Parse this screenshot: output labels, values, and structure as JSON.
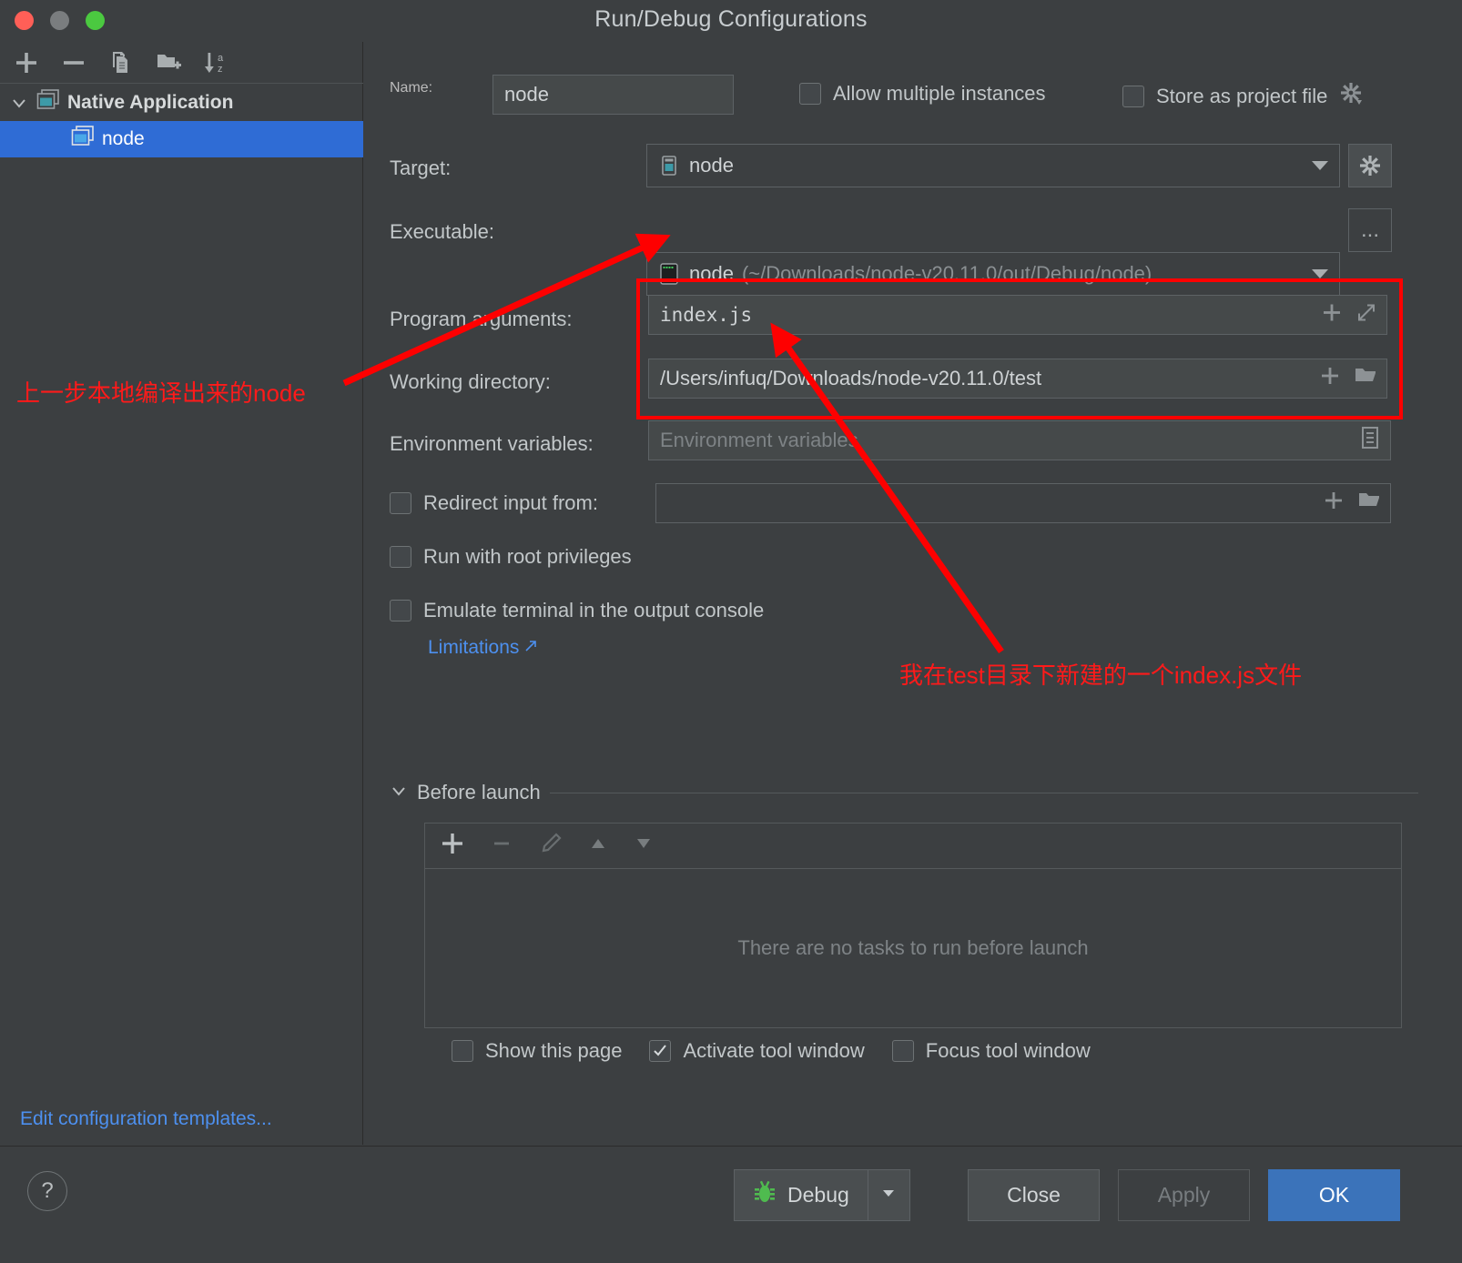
{
  "window": {
    "title": "Run/Debug Configurations",
    "traffic_lights": [
      "close-button",
      "minimize-button",
      "maximize-button"
    ]
  },
  "sidebar": {
    "toolbar": [
      {
        "name": "add-configuration-button",
        "icon": "plus-icon"
      },
      {
        "name": "remove-configuration-button",
        "icon": "minus-icon"
      },
      {
        "name": "copy-configuration-button",
        "icon": "copy-icon"
      },
      {
        "name": "new-folder-button",
        "icon": "folder-add-icon"
      },
      {
        "name": "sort-configurations-button",
        "icon": "sort-alpha-icon"
      }
    ],
    "tree": [
      {
        "label": "Native Application",
        "type": "group",
        "expanded": true,
        "icon": "native-app-icon"
      },
      {
        "label": "node",
        "type": "child",
        "selected": true,
        "icon": "native-app-icon"
      }
    ],
    "edit_templates_link": "Edit configuration templates..."
  },
  "form": {
    "name_label": "Name:",
    "name_value": "node",
    "allow_multiple_instances": {
      "label": "Allow multiple instances",
      "checked": false
    },
    "store_as_project_file": {
      "label": "Store as project file",
      "checked": false,
      "gear_icon": "gear-icon"
    },
    "target_label": "Target:",
    "target_value": "node",
    "target_gear_icon": "gear-icon",
    "executable_label": "Executable:",
    "executable_value": "node",
    "executable_path_hint": "(~/Downloads/node-v20.11.0/out/Debug/node)",
    "executable_browse_label": "...",
    "program_arguments_label": "Program arguments:",
    "program_arguments_value": "index.js",
    "program_arguments_icons": [
      "plus-icon",
      "expand-icon"
    ],
    "working_directory_label": "Working directory:",
    "working_directory_value": "/Users/infuq/Downloads/node-v20.11.0/test",
    "working_directory_icons": [
      "plus-icon",
      "folder-icon"
    ],
    "environment_variables_label": "Environment variables:",
    "environment_variables_placeholder": "Environment variables",
    "environment_variables_value": "",
    "environment_variables_icon": "list-edit-icon",
    "redirect_input_from": {
      "label": "Redirect input from:",
      "checked": false,
      "value": "",
      "icons": [
        "plus-icon",
        "folder-icon"
      ]
    },
    "run_with_root_privileges": {
      "label": "Run with root privileges",
      "checked": false
    },
    "emulate_terminal": {
      "label": "Emulate terminal in the output console",
      "checked": false
    },
    "limitations_link": "Limitations"
  },
  "before_launch": {
    "title": "Before launch",
    "expanded": true,
    "toolbar": [
      {
        "name": "add-task-button",
        "icon": "plus-icon",
        "enabled": true
      },
      {
        "name": "remove-task-button",
        "icon": "minus-icon",
        "enabled": false
      },
      {
        "name": "edit-task-button",
        "icon": "pencil-icon",
        "enabled": false
      },
      {
        "name": "move-task-up-button",
        "icon": "triangle-up-icon",
        "enabled": false
      },
      {
        "name": "move-task-down-button",
        "icon": "triangle-down-icon",
        "enabled": false
      }
    ],
    "empty_text": "There are no tasks to run before launch",
    "checkboxes": [
      {
        "label": "Show this page",
        "checked": false
      },
      {
        "label": "Activate tool window",
        "checked": true
      },
      {
        "label": "Focus tool window",
        "checked": false
      }
    ]
  },
  "footer": {
    "help_label": "?",
    "debug_label": "Debug",
    "debug_icon": "bug-icon",
    "close_label": "Close",
    "apply_label": "Apply",
    "apply_enabled": false,
    "ok_label": "OK"
  },
  "annotations": {
    "note_executable": "上一步本地编译出来的node",
    "note_index_js": "我在test目录下新建的一个index.js文件",
    "highlight_color": "#fe0000"
  }
}
